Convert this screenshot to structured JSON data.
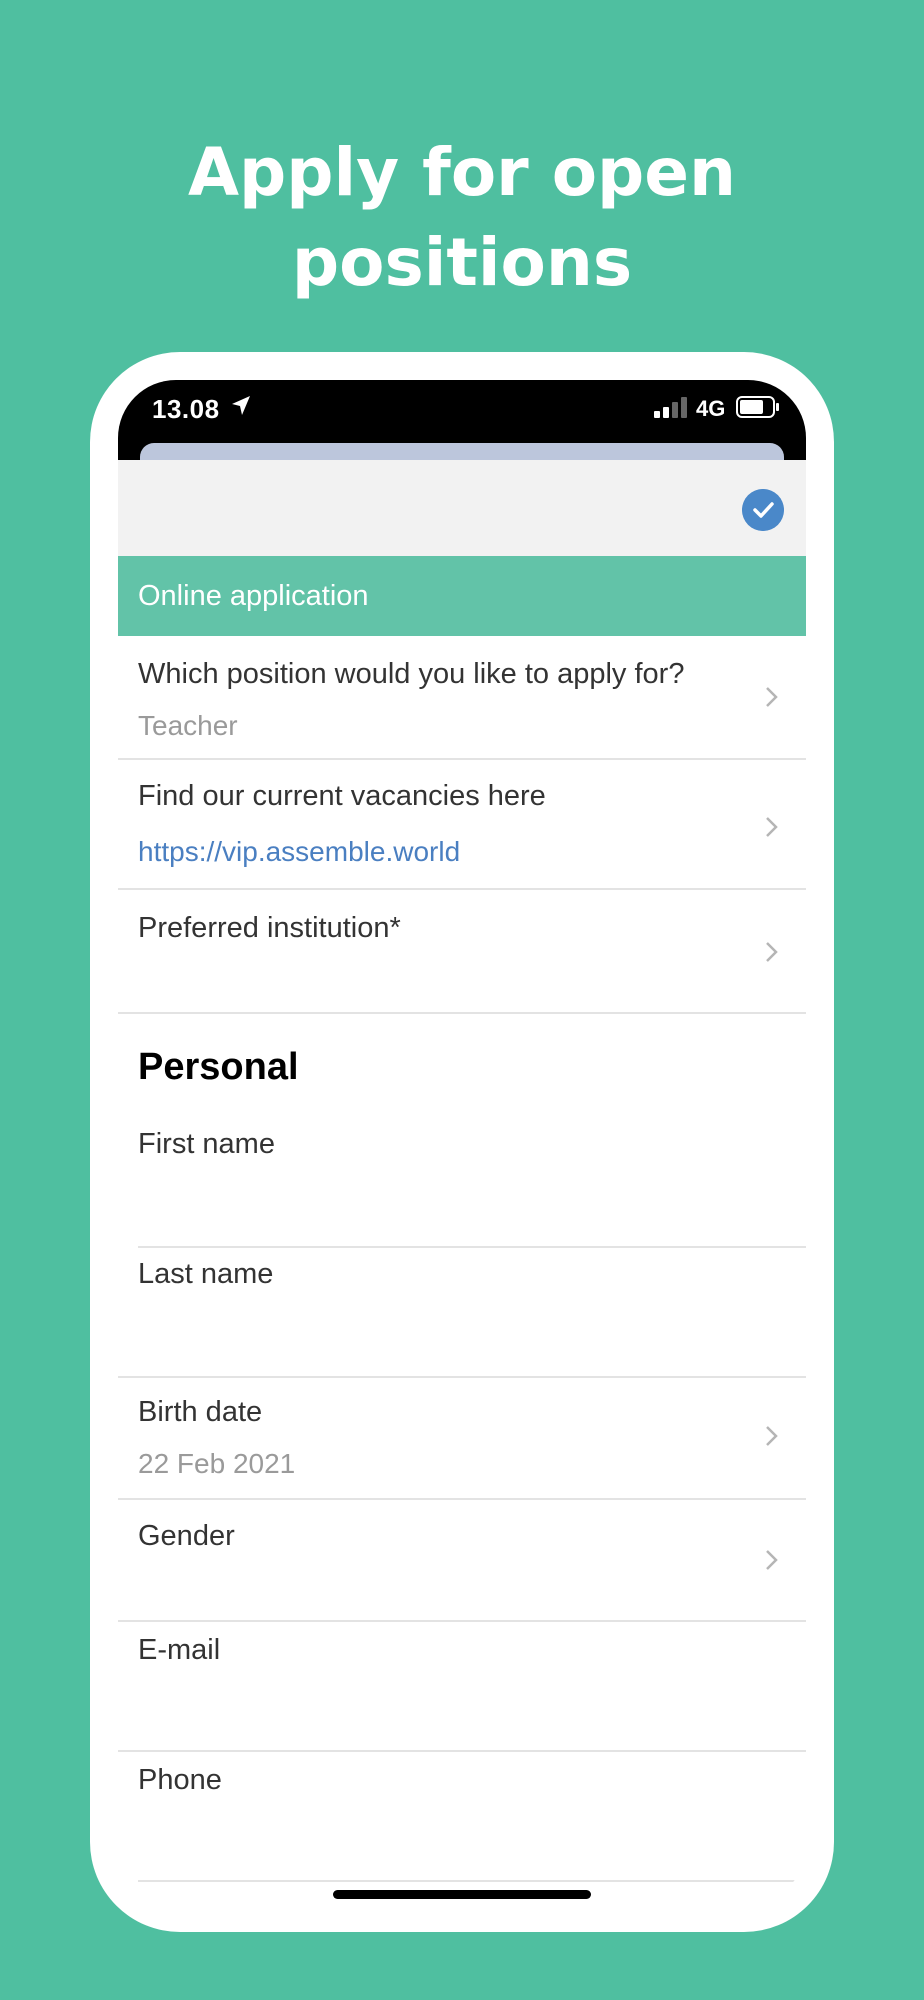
{
  "promo": {
    "headline": [
      "Apply for open",
      "positions"
    ]
  },
  "status_bar": {
    "time": "13.08",
    "network": "4G",
    "icons": [
      "location-arrow-icon",
      "signal-icon",
      "battery-icon"
    ]
  },
  "header": {
    "icon": "checkmark-circle-icon"
  },
  "form": {
    "section_title": "Online application",
    "position": {
      "label": "Which position would you like to apply for?",
      "value": "Teacher"
    },
    "vacancies": {
      "label": "Find our current vacancies here",
      "link": "https://vip.assemble.world"
    },
    "institution": {
      "label": "Preferred institution*"
    },
    "personal": {
      "heading": "Personal",
      "first_name": {
        "label": "First name"
      },
      "last_name": {
        "label": "Last name"
      },
      "birth_date": {
        "label": "Birth date",
        "value": "22 Feb 2021"
      },
      "gender": {
        "label": "Gender"
      },
      "email": {
        "label": "E-mail"
      },
      "phone": {
        "label": "Phone"
      }
    }
  },
  "colors": {
    "background": "#4fbfa0",
    "section_banner": "#62c3a8",
    "link": "#4a7fc1",
    "check": "#4a88c9"
  }
}
